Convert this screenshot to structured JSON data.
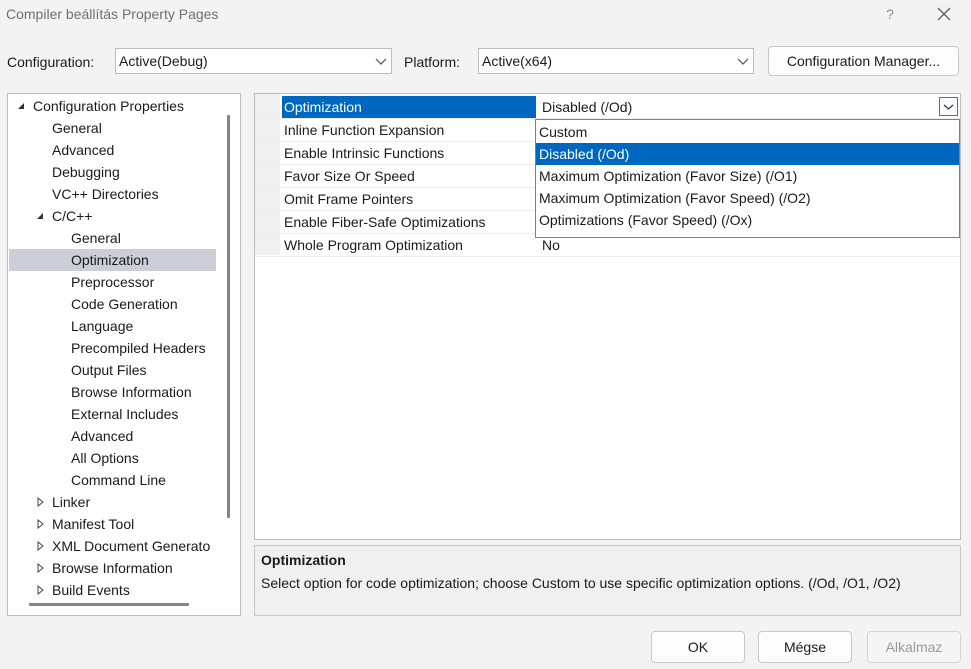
{
  "window": {
    "title": "Compiler beállítás Property Pages",
    "help_label": "?"
  },
  "config": {
    "configuration_label": "Configuration:",
    "configuration_value": "Active(Debug)",
    "platform_label": "Platform:",
    "platform_value": "Active(x64)",
    "manager_button": "Configuration Manager..."
  },
  "tree": {
    "items": [
      {
        "label": "Configuration Properties",
        "expanded": true
      },
      {
        "label": "General"
      },
      {
        "label": "Advanced"
      },
      {
        "label": "Debugging"
      },
      {
        "label": "VC++ Directories"
      },
      {
        "label": "C/C++",
        "expanded": true
      },
      {
        "label": "General"
      },
      {
        "label": "Optimization",
        "selected": true
      },
      {
        "label": "Preprocessor"
      },
      {
        "label": "Code Generation"
      },
      {
        "label": "Language"
      },
      {
        "label": "Precompiled Headers"
      },
      {
        "label": "Output Files"
      },
      {
        "label": "Browse Information"
      },
      {
        "label": "External Includes"
      },
      {
        "label": "Advanced"
      },
      {
        "label": "All Options"
      },
      {
        "label": "Command Line"
      },
      {
        "label": "Linker",
        "expanded": false
      },
      {
        "label": "Manifest Tool",
        "expanded": false
      },
      {
        "label": "XML Document Generato",
        "expanded": false
      },
      {
        "label": "Browse Information",
        "expanded": false
      },
      {
        "label": "Build Events",
        "expanded": false
      }
    ]
  },
  "grid": {
    "rows": [
      {
        "name": "Optimization",
        "value": "Disabled (/Od)",
        "selected": true
      },
      {
        "name": "Inline Function Expansion",
        "value": ""
      },
      {
        "name": "Enable Intrinsic Functions",
        "value": ""
      },
      {
        "name": "Favor Size Or Speed",
        "value": ""
      },
      {
        "name": "Omit Frame Pointers",
        "value": ""
      },
      {
        "name": "Enable Fiber-Safe Optimizations",
        "value": ""
      },
      {
        "name": "Whole Program Optimization",
        "value": "No"
      }
    ]
  },
  "dropdown": {
    "options": [
      {
        "label": "Custom"
      },
      {
        "label": "Disabled (/Od)",
        "selected": true
      },
      {
        "label": "Maximum Optimization (Favor Size) (/O1)"
      },
      {
        "label": "Maximum Optimization (Favor Speed) (/O2)"
      },
      {
        "label": "Optimizations (Favor Speed) (/Ox)"
      }
    ]
  },
  "description": {
    "title": "Optimization",
    "text": "Select option for code optimization; choose Custom to use specific optimization options.      (/Od, /O1, /O2)"
  },
  "buttons": {
    "ok": "OK",
    "cancel": "Mégse",
    "apply": "Alkalmaz"
  },
  "colors": {
    "accent": "#0067c0",
    "tree_selection": "#ccced8"
  }
}
